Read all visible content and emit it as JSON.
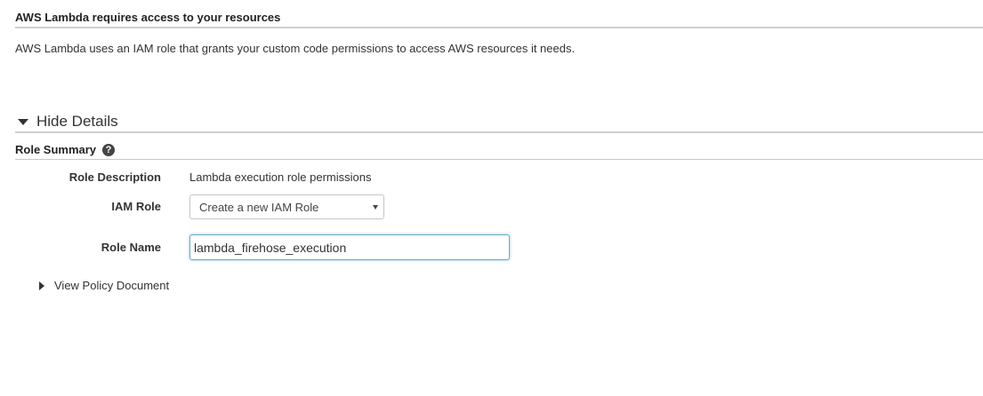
{
  "header": {
    "title": "AWS Lambda requires access to your resources",
    "description": "AWS Lambda uses an IAM role that grants your custom code permissions to access AWS resources it needs."
  },
  "details_toggle": {
    "label": "Hide Details",
    "icon": "caret-down-icon"
  },
  "role_summary": {
    "title": "Role Summary",
    "help_icon": "?",
    "fields": {
      "description_label": "Role Description",
      "description_value": "Lambda execution role permissions",
      "iam_role_label": "IAM Role",
      "iam_role_selected": "Create a new IAM Role",
      "role_name_label": "Role Name",
      "role_name_value": "lambda_firehose_execution"
    }
  },
  "policy_toggle": {
    "label": "View Policy Document",
    "icon": "caret-right-icon"
  }
}
